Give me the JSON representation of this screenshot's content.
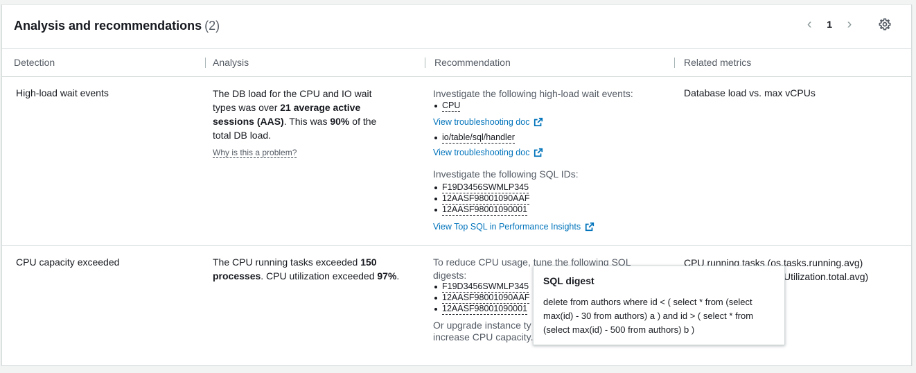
{
  "header": {
    "title": "Analysis and recommendations",
    "count": "(2)",
    "page_number": "1",
    "prev_icon": "chevron-left-icon",
    "next_icon": "chevron-right-icon",
    "settings_icon": "gear-icon"
  },
  "columns": {
    "detection": "Detection",
    "analysis": "Analysis",
    "recommendation": "Recommendation",
    "related_metrics": "Related metrics"
  },
  "rows": [
    {
      "detection": "High-load wait events",
      "analysis": {
        "p1": "The DB load for the CPU and IO wait",
        "p2": "types was over ",
        "p2b": "21 average active",
        "p3b": "sessions (AAS)",
        "p3": ". This was ",
        "p3c": "90%",
        "p3d": " of the",
        "p4": "total DB load.",
        "why": "Why is this a problem?"
      },
      "recommendation": {
        "intro": "Investigate the following high-load wait events:",
        "wait_events": [
          "CPU",
          "io/table/sql/handler"
        ],
        "doc_link": "View troubleshooting doc",
        "sql_intro": "Investigate the following SQL IDs:",
        "sql_ids": [
          "F19D3456SWMLP345",
          "12AASF98001090AAF",
          "12AASF98001090001"
        ],
        "top_sql_link": "View Top SQL in Performance Insights"
      },
      "related_metrics": "Database load vs. max vCPUs"
    },
    {
      "detection": "CPU capacity exceeded",
      "analysis": {
        "p1a": "The CPU running tasks exceeded ",
        "p1b": "150",
        "p2a": "processes",
        "p2b": ". CPU utilization exceeded ",
        "p2c": "97%",
        "p2d": "."
      },
      "recommendation": {
        "intro_1": "To reduce CPU usage, tune the following SQL",
        "intro_2": "digests:",
        "sql_digests": [
          "F19D3456SWMLP345",
          "12AASF98001090AAF",
          "12AASF98001090001"
        ],
        "upgrade_1": "Or upgrade instance ty",
        "upgrade_2": "increase CPU capacity."
      },
      "related_metrics": {
        "m1": "CPU running tasks (os.tasks.running.avg)",
        "m2": "Utilization.total.avg)"
      }
    }
  ],
  "tooltip": {
    "title": "SQL digest",
    "body": "delete from authors where id < ( select * from (select max(id) - 30 from authors) a ) and id > ( select * from (select max(id) - 500 from authors) b )"
  },
  "colors": {
    "link": "#0073bb",
    "text": "#16191f",
    "muted": "#545b64",
    "border": "#d5dbdb"
  }
}
